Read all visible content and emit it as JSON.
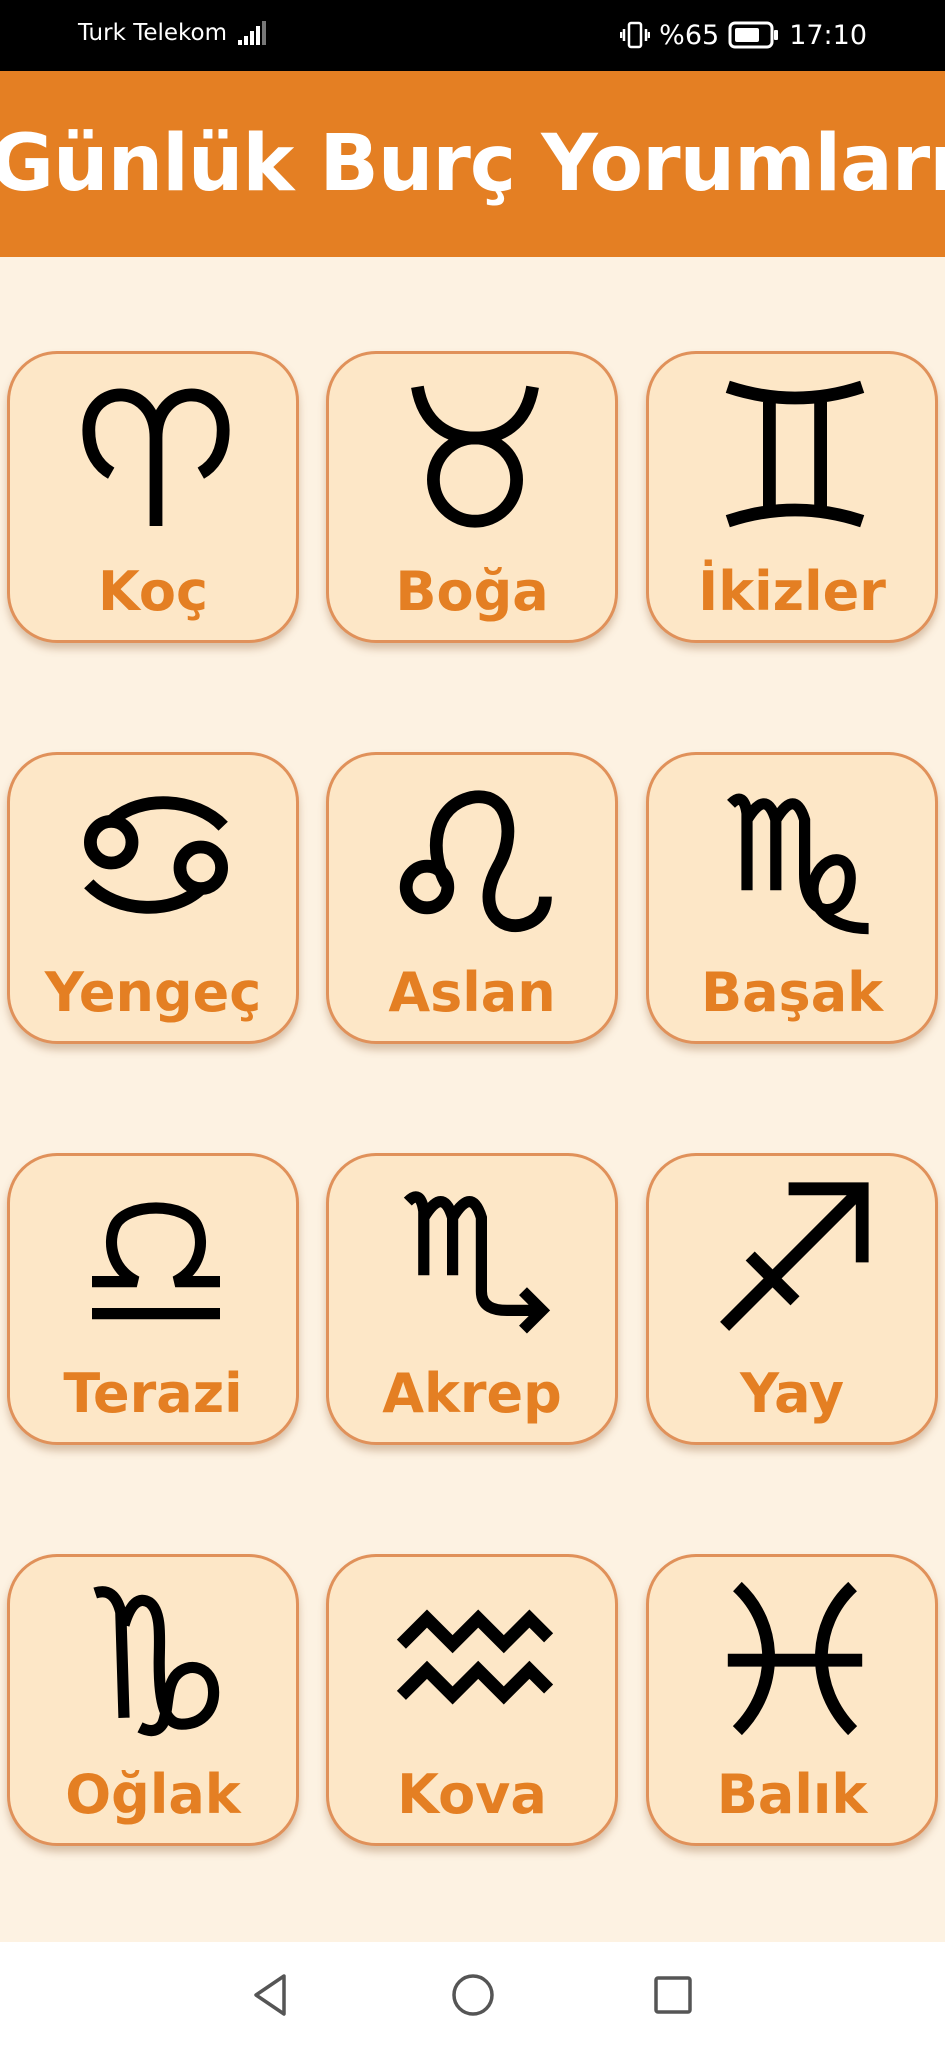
{
  "status_bar": {
    "carrier": "Turk Telekom",
    "battery": "%65",
    "time": "17:10",
    "icons": [
      "signal-icon",
      "vibrate-icon",
      "battery-icon"
    ]
  },
  "header": {
    "title": "Günlük Burç Yorumları",
    "background": "#e47f23",
    "text_color": "#ffffff"
  },
  "signs": [
    {
      "label": "Koç",
      "icon": "aries-icon"
    },
    {
      "label": "Boğa",
      "icon": "taurus-icon"
    },
    {
      "label": "İkizler",
      "icon": "gemini-icon"
    },
    {
      "label": "Yengeç",
      "icon": "cancer-icon"
    },
    {
      "label": "Aslan",
      "icon": "leo-icon"
    },
    {
      "label": "Başak",
      "icon": "virgo-icon"
    },
    {
      "label": "Terazi",
      "icon": "libra-icon"
    },
    {
      "label": "Akrep",
      "icon": "scorpio-icon"
    },
    {
      "label": "Yay",
      "icon": "sagittarius-icon"
    },
    {
      "label": "Oğlak",
      "icon": "capricorn-icon"
    },
    {
      "label": "Kova",
      "icon": "aquarius-icon"
    },
    {
      "label": "Balık",
      "icon": "pisces-icon"
    }
  ],
  "colors": {
    "page_background": "#fdf2e2",
    "card_background": "#fde7c7",
    "card_border": "#e0915a",
    "label_color": "#e47f23"
  },
  "nav_bar": {
    "icons": [
      "back-icon",
      "home-icon",
      "recents-icon"
    ]
  }
}
